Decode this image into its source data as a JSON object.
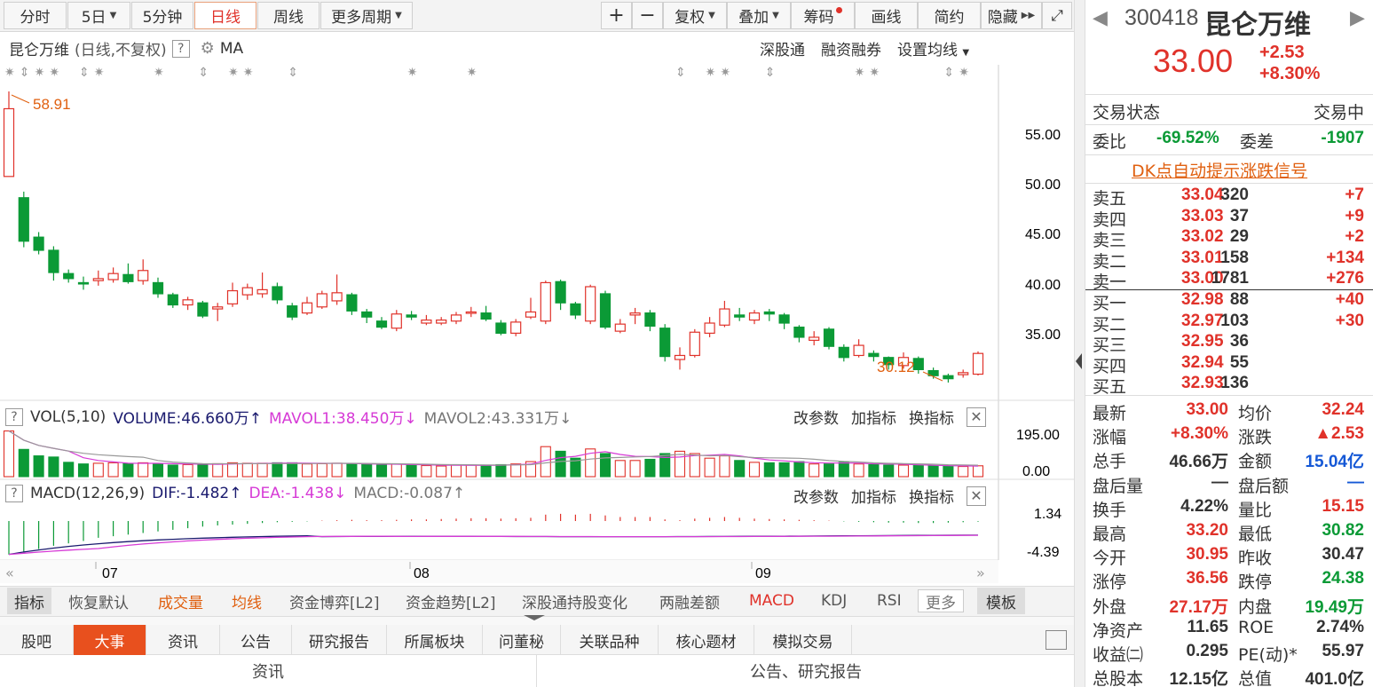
{
  "toolbar": {
    "periods": [
      "分时",
      "5日",
      "5分钟",
      "日线",
      "周线",
      "更多周期"
    ],
    "active": "日线",
    "tools": [
      "+",
      "−",
      "复权",
      "叠加",
      "筹码",
      "画线",
      "简约",
      "隐藏"
    ]
  },
  "chart": {
    "stock_name": "昆仑万维",
    "subtitle": "(日线,不复权)",
    "help": "?",
    "ma_label": "MA",
    "links": [
      "深股通",
      "融资融券",
      "设置均线"
    ],
    "high_note": "58.91",
    "low_note": "30.12",
    "price_axis": [
      "55.00",
      "50.00",
      "45.00",
      "40.00",
      "35.00"
    ],
    "vol_axis": [
      "195.00",
      "0.00"
    ],
    "macd_axis": [
      "1.34",
      "-4.39"
    ],
    "months": [
      "07",
      "08",
      "09"
    ]
  },
  "volume": {
    "name": "VOL(5,10)",
    "volume": "VOLUME:46.660万",
    "mavol1": "MAVOL1:38.450万",
    "mavol2": "MAVOL2:43.331万",
    "up_arrow": "↑",
    "down_arrow": "↓",
    "actions": [
      "改参数",
      "加指标",
      "换指标"
    ]
  },
  "macd": {
    "name": "MACD(12,26,9)",
    "dif": "DIF:-1.482",
    "dea": "DEA:-1.438",
    "macd": "MACD:-0.087",
    "actions": [
      "改参数",
      "加指标",
      "换指标"
    ]
  },
  "indicator_tabs": [
    "指标",
    "恢复默认",
    "成交量",
    "均线",
    "资金博弈[L2]",
    "资金趋势[L2]",
    "深股通持股变化",
    "两融差额",
    "MACD",
    "KDJ",
    "RSI",
    "更多",
    "模板"
  ],
  "bottom_tabs": [
    "股吧",
    "大事",
    "资讯",
    "公告",
    "研究报告",
    "所属板块",
    "问董秘",
    "关联品种",
    "核心题材",
    "模拟交易"
  ],
  "bottom_headers": [
    "资讯",
    "公告、研究报告"
  ],
  "panel": {
    "code": "300418",
    "name": "昆仑万维",
    "price": "33.00",
    "change": "+2.53",
    "change_pct": "+8.30%",
    "status_label": "交易状态",
    "status_value": "交易中",
    "webi_label": "委比",
    "webi_value": "-69.52%",
    "weicha_label": "委差",
    "weicha_value": "-1907",
    "dk_signal": "DK点自动提示涨跌信号",
    "asks": [
      {
        "label": "卖五",
        "price": "33.04",
        "vol": "320",
        "chg": "+7"
      },
      {
        "label": "卖四",
        "price": "33.03",
        "vol": "37",
        "chg": "+9"
      },
      {
        "label": "卖三",
        "price": "33.02",
        "vol": "29",
        "chg": "+2"
      },
      {
        "label": "卖二",
        "price": "33.01",
        "vol": "158",
        "chg": "+134"
      },
      {
        "label": "卖一",
        "price": "33.00",
        "vol": "1781",
        "chg": "+276"
      }
    ],
    "bids": [
      {
        "label": "买一",
        "price": "32.98",
        "vol": "88",
        "chg": "+40"
      },
      {
        "label": "买二",
        "price": "32.97",
        "vol": "103",
        "chg": "+30"
      },
      {
        "label": "买三",
        "price": "32.95",
        "vol": "36",
        "chg": ""
      },
      {
        "label": "买四",
        "price": "32.94",
        "vol": "55",
        "chg": ""
      },
      {
        "label": "买五",
        "price": "32.93",
        "vol": "136",
        "chg": ""
      }
    ],
    "stats": [
      [
        "最新",
        "33.00",
        "red",
        "均价",
        "32.24",
        "red"
      ],
      [
        "涨幅",
        "+8.30%",
        "red",
        "涨跌",
        "▲2.53",
        "red"
      ],
      [
        "总手",
        "46.66万",
        "dark",
        "金额",
        "15.04亿",
        "blue"
      ],
      [
        "盘后量",
        "—",
        "dark",
        "盘后额",
        "—",
        "blue"
      ],
      [
        "换手",
        "4.22%",
        "dark",
        "量比",
        "15.15",
        "red"
      ],
      [
        "最高",
        "33.20",
        "red",
        "最低",
        "30.82",
        "green"
      ],
      [
        "今开",
        "30.95",
        "red",
        "昨收",
        "30.47",
        "dark"
      ],
      [
        "涨停",
        "36.56",
        "red",
        "跌停",
        "24.38",
        "green"
      ],
      [
        "外盘",
        "27.17万",
        "red",
        "内盘",
        "19.49万",
        "green"
      ],
      [
        "净资产",
        "11.65",
        "dark",
        "ROE",
        "2.74%",
        "dark"
      ],
      [
        "收益㈡",
        "0.295",
        "dark",
        "PE(动)*",
        "55.97",
        "dark"
      ],
      [
        "总股本",
        "12.15亿",
        "dark",
        "总值",
        "401.0亿",
        "dark"
      ]
    ]
  },
  "chart_data": {
    "type": "candlestick",
    "ylim": [
      30,
      59
    ],
    "candles": [
      {
        "o": 50.5,
        "c": 57.2,
        "h": 58.91,
        "l": 50.5
      },
      {
        "o": 48.4,
        "c": 44.1,
        "h": 49.0,
        "l": 43.5
      },
      {
        "o": 44.5,
        "c": 43.2,
        "h": 45.0,
        "l": 42.8
      },
      {
        "o": 43.2,
        "c": 41.0,
        "h": 43.6,
        "l": 40.2
      },
      {
        "o": 40.9,
        "c": 40.4,
        "h": 41.3,
        "l": 40.0
      },
      {
        "o": 40.0,
        "c": 39.9,
        "h": 40.6,
        "l": 39.3
      },
      {
        "o": 40.2,
        "c": 40.4,
        "h": 41.2,
        "l": 39.7
      },
      {
        "o": 40.3,
        "c": 40.9,
        "h": 41.5,
        "l": 40.0
      },
      {
        "o": 40.8,
        "c": 40.1,
        "h": 41.9,
        "l": 39.9
      },
      {
        "o": 40.2,
        "c": 41.2,
        "h": 42.3,
        "l": 39.8
      },
      {
        "o": 40.0,
        "c": 38.9,
        "h": 40.5,
        "l": 38.5
      },
      {
        "o": 38.8,
        "c": 37.8,
        "h": 39.0,
        "l": 37.5
      },
      {
        "o": 37.8,
        "c": 38.3,
        "h": 38.6,
        "l": 37.3
      },
      {
        "o": 38.0,
        "c": 36.7,
        "h": 38.2,
        "l": 36.5
      },
      {
        "o": 37.4,
        "c": 37.6,
        "h": 38.0,
        "l": 36.2
      },
      {
        "o": 37.9,
        "c": 39.2,
        "h": 40.0,
        "l": 37.6
      },
      {
        "o": 38.8,
        "c": 39.5,
        "h": 39.9,
        "l": 38.3
      },
      {
        "o": 38.9,
        "c": 39.3,
        "h": 41.0,
        "l": 38.5
      },
      {
        "o": 39.6,
        "c": 38.3,
        "h": 40.0,
        "l": 37.9
      },
      {
        "o": 37.7,
        "c": 36.6,
        "h": 38.0,
        "l": 36.3
      },
      {
        "o": 37.0,
        "c": 38.0,
        "h": 38.6,
        "l": 36.8
      },
      {
        "o": 37.6,
        "c": 38.9,
        "h": 39.2,
        "l": 37.4
      },
      {
        "o": 38.2,
        "c": 39.0,
        "h": 40.8,
        "l": 37.8
      },
      {
        "o": 38.8,
        "c": 37.2,
        "h": 39.0,
        "l": 36.8
      },
      {
        "o": 37.1,
        "c": 36.6,
        "h": 37.4,
        "l": 36.0
      },
      {
        "o": 36.2,
        "c": 35.6,
        "h": 36.6,
        "l": 35.4
      },
      {
        "o": 35.5,
        "c": 36.9,
        "h": 37.3,
        "l": 35.2
      },
      {
        "o": 36.8,
        "c": 36.6,
        "h": 37.2,
        "l": 36.3
      },
      {
        "o": 36.0,
        "c": 36.3,
        "h": 36.8,
        "l": 35.8
      },
      {
        "o": 36.0,
        "c": 36.3,
        "h": 36.6,
        "l": 35.8
      },
      {
        "o": 36.2,
        "c": 36.8,
        "h": 37.1,
        "l": 35.9
      },
      {
        "o": 37.0,
        "c": 37.1,
        "h": 37.6,
        "l": 36.6
      },
      {
        "o": 37.0,
        "c": 36.4,
        "h": 37.7,
        "l": 36.2
      },
      {
        "o": 36.0,
        "c": 35.0,
        "h": 36.3,
        "l": 34.8
      },
      {
        "o": 35.0,
        "c": 36.1,
        "h": 36.4,
        "l": 34.7
      },
      {
        "o": 36.6,
        "c": 37.1,
        "h": 38.5,
        "l": 36.4
      },
      {
        "o": 36.2,
        "c": 40.0,
        "h": 40.2,
        "l": 35.9
      },
      {
        "o": 40.1,
        "c": 38.0,
        "h": 40.3,
        "l": 37.3
      },
      {
        "o": 37.9,
        "c": 36.8,
        "h": 38.1,
        "l": 36.4
      },
      {
        "o": 36.2,
        "c": 39.6,
        "h": 39.8,
        "l": 35.9
      },
      {
        "o": 38.9,
        "c": 35.6,
        "h": 39.2,
        "l": 35.4
      },
      {
        "o": 35.2,
        "c": 35.9,
        "h": 36.4,
        "l": 35.0
      },
      {
        "o": 36.8,
        "c": 37.0,
        "h": 37.5,
        "l": 35.9
      },
      {
        "o": 37.0,
        "c": 35.7,
        "h": 37.3,
        "l": 35.2
      },
      {
        "o": 35.5,
        "c": 32.7,
        "h": 35.9,
        "l": 32.2
      },
      {
        "o": 32.4,
        "c": 32.8,
        "h": 33.6,
        "l": 31.4
      },
      {
        "o": 32.8,
        "c": 35.1,
        "h": 35.4,
        "l": 32.6
      },
      {
        "o": 35.0,
        "c": 36.0,
        "h": 36.6,
        "l": 34.6
      },
      {
        "o": 35.8,
        "c": 37.4,
        "h": 38.2,
        "l": 35.6
      },
      {
        "o": 36.8,
        "c": 36.6,
        "h": 37.5,
        "l": 36.2
      },
      {
        "o": 36.3,
        "c": 37.0,
        "h": 37.3,
        "l": 35.9
      },
      {
        "o": 37.1,
        "c": 36.9,
        "h": 37.4,
        "l": 36.2
      },
      {
        "o": 36.8,
        "c": 36.0,
        "h": 37.0,
        "l": 35.4
      },
      {
        "o": 35.6,
        "c": 34.6,
        "h": 35.8,
        "l": 34.1
      },
      {
        "o": 34.3,
        "c": 34.6,
        "h": 35.2,
        "l": 33.8
      },
      {
        "o": 35.4,
        "c": 33.7,
        "h": 35.6,
        "l": 33.4
      },
      {
        "o": 33.6,
        "c": 32.6,
        "h": 33.9,
        "l": 32.2
      },
      {
        "o": 32.8,
        "c": 33.8,
        "h": 34.4,
        "l": 32.6
      },
      {
        "o": 33.0,
        "c": 32.7,
        "h": 33.3,
        "l": 32.2
      },
      {
        "o": 32.6,
        "c": 31.9,
        "h": 32.7,
        "l": 31.4
      },
      {
        "o": 31.8,
        "c": 32.6,
        "h": 33.1,
        "l": 31.5
      },
      {
        "o": 32.5,
        "c": 31.4,
        "h": 32.7,
        "l": 31.0
      },
      {
        "o": 31.3,
        "c": 30.8,
        "h": 31.6,
        "l": 30.5
      },
      {
        "o": 30.8,
        "c": 30.5,
        "h": 31.0,
        "l": 30.12
      },
      {
        "o": 30.9,
        "c": 31.1,
        "h": 31.4,
        "l": 30.6
      },
      {
        "o": 30.95,
        "c": 33.0,
        "h": 33.2,
        "l": 30.82
      }
    ],
    "volume": [
      198,
      118,
      90,
      85,
      62,
      55,
      58,
      60,
      56,
      60,
      55,
      50,
      52,
      55,
      56,
      60,
      58,
      58,
      60,
      60,
      55,
      56,
      58,
      55,
      52,
      50,
      55,
      50,
      48,
      46,
      50,
      50,
      50,
      52,
      55,
      65,
      130,
      110,
      80,
      120,
      100,
      70,
      70,
      75,
      100,
      110,
      100,
      80,
      90,
      70,
      62,
      60,
      60,
      65,
      55,
      55,
      62,
      55,
      52,
      50,
      50,
      48,
      46,
      44,
      44,
      47
    ],
    "macd_hist": [
      -4.2,
      -3.9,
      -3.5,
      -3.1,
      -2.8,
      -2.5,
      -2.1,
      -1.9,
      -1.7,
      -1.5,
      -1.3,
      -1.1,
      -0.9,
      -0.7,
      -0.55,
      -0.45,
      -0.35,
      -0.25,
      -0.15,
      -0.1,
      -0.05,
      0.05,
      0.1,
      0.15,
      0.1,
      0.1,
      0.15,
      0.2,
      0.2,
      0.25,
      0.3,
      0.35,
      0.35,
      0.3,
      0.35,
      0.4,
      0.8,
      0.9,
      0.8,
      0.9,
      0.7,
      0.5,
      0.5,
      0.5,
      0.2,
      0.1,
      0.3,
      0.4,
      0.5,
      0.4,
      0.3,
      0.25,
      0.2,
      0.15,
      0.1,
      0.05,
      -0.05,
      -0.1,
      -0.15,
      -0.2,
      -0.2,
      -0.25,
      -0.25,
      -0.2,
      -0.15,
      -0.087
    ]
  }
}
